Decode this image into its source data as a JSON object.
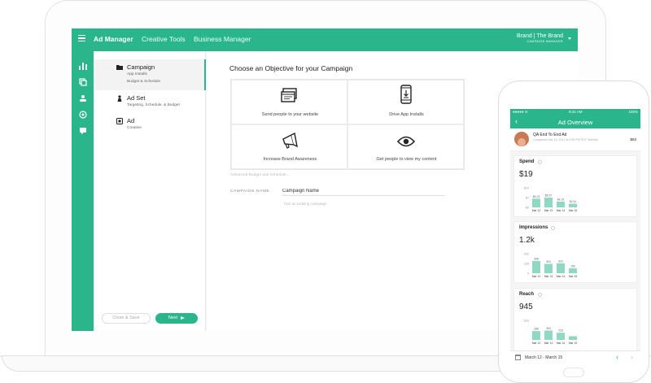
{
  "colors": {
    "accent": "#2bb58a",
    "chart_bar": "#8fd9c2"
  },
  "nav": {
    "menu_icon": "hamburger-menu-icon",
    "items": [
      "Ad Manager",
      "Creative Tools",
      "Business Manager"
    ],
    "brand_name": "Brand | The Brand",
    "brand_sub": "CAMPAIGN MANAGER"
  },
  "sidebar": {
    "icons": [
      "bar-chart-icon",
      "layers-icon",
      "people-icon",
      "target-icon",
      "message-icon"
    ]
  },
  "steps": [
    {
      "title": "Campaign",
      "subs": [
        "App Installs",
        "Budget & Schedule"
      ],
      "icon": "folder-icon"
    },
    {
      "title": "Ad Set",
      "subs": [
        "Targeting, Schedule, & Budget"
      ],
      "icon": "person-icon"
    },
    {
      "title": "Ad",
      "subs": [
        "Creative"
      ],
      "icon": "ad-icon"
    }
  ],
  "buttons": {
    "close_save": "Close & Save",
    "next": "Next"
  },
  "main": {
    "title": "Choose an Objective for your Campaign",
    "objectives": [
      {
        "label": "Send people to your website",
        "icon": "website-icon"
      },
      {
        "label": "Drive App Installs",
        "icon": "phone-download-icon"
      },
      {
        "label": "Increase Brand Awareness",
        "icon": "megaphone-icon"
      },
      {
        "label": "Get people to view my content",
        "icon": "eye-icon"
      }
    ],
    "advanced_link": "Advanced Budget and Schedule...",
    "campaign_label": "CAMPAIGN NAME",
    "campaign_value": "Campaign Name",
    "campaign_hint": "Use an existing campaign"
  },
  "phone": {
    "status_left": "●●●●● ≋",
    "status_time": "9:41 AM",
    "status_right": "100%",
    "title": "Ad Overview",
    "ad_name": "QA End To End Ad",
    "ad_meta": "Completed Mar 15, 2017 at 5:59 PM PDT Website",
    "ad_amount": "$93",
    "date_range": "March 12 - March 15",
    "cards": [
      {
        "title": "Spend",
        "value": "$19"
      },
      {
        "title": "Impressions",
        "value": "1.2k"
      },
      {
        "title": "Reach",
        "value": "945"
      }
    ]
  },
  "chart_data": [
    {
      "type": "bar",
      "title": "Spend",
      "categories": [
        "Mar 12",
        "Mar 13",
        "Mar 14",
        "Mar 15"
      ],
      "values": [
        6.23,
        6.97,
        4.15,
        2.61
      ],
      "value_labels": [
        "$6.23",
        "$6.97",
        "$4.15",
        "$2.61"
      ],
      "yticks": [
        "$14",
        "$7",
        "$0"
      ],
      "ylim": [
        0,
        14
      ]
    },
    {
      "type": "bar",
      "title": "Impressions",
      "categories": [
        "Mar 12",
        "Mar 13",
        "Mar 14",
        "Mar 15"
      ],
      "values": [
        398,
        304,
        323,
        156
      ],
      "value_labels": [
        "398",
        "304",
        "323",
        "156"
      ],
      "yticks": [
        "633",
        "316",
        "0"
      ],
      "ylim": [
        0,
        633
      ]
    },
    {
      "type": "bar",
      "title": "Reach",
      "categories": [
        "Mar 12",
        "Mar 13",
        "Mar 14",
        "Mar 15"
      ],
      "values": [
        288,
        304,
        233,
        120
      ],
      "value_labels": [
        "288",
        "304",
        "233",
        ""
      ],
      "yticks": [
        "633"
      ],
      "ylim": [
        0,
        633
      ]
    }
  ]
}
